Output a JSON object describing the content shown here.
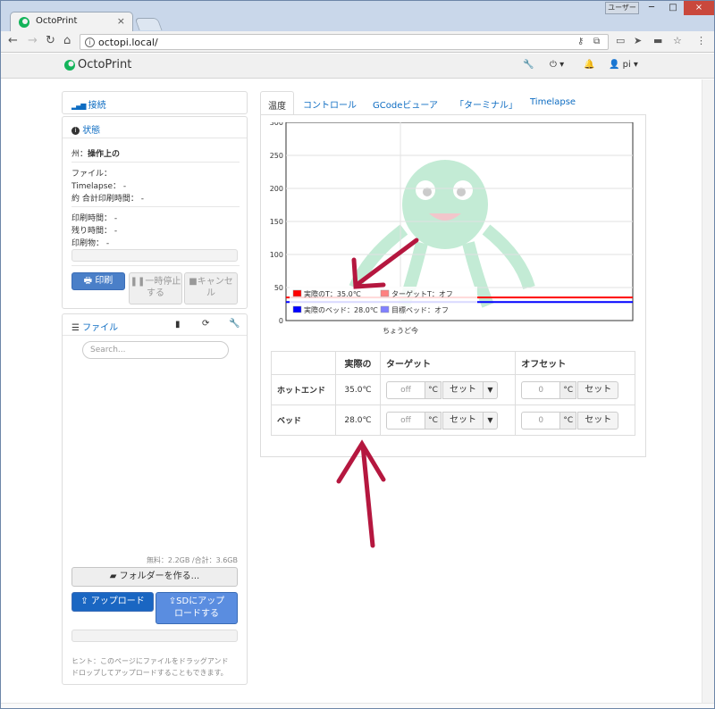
{
  "browser": {
    "tab_title": "OctoPrint",
    "tab_close": "×",
    "user_badge": "ユーザー",
    "url": "octopi.local/",
    "window_min": "─",
    "window_max": "□",
    "window_close": "×"
  },
  "navbar": {
    "brand": "OctoPrint",
    "wrench": "🔧",
    "power": "⏻ ▾",
    "bell": "🔔",
    "user": "👤 pi ▾"
  },
  "sidebar": {
    "connection": {
      "label": "接続"
    },
    "state": {
      "label": "状態",
      "state_label": "州",
      "state_value": "操作上の",
      "file_label": "ファイル：",
      "timelapse_label": "Timelapse：",
      "timelapse_value": "-",
      "approx_label": "約 合計印刷時間：",
      "approx_value": "-",
      "print_time_label": "印刷時間：",
      "print_time_value": "-",
      "remaining_label": "残り時間：",
      "remaining_value": "-",
      "printed_label": "印刷物：",
      "printed_value": "-",
      "progress": 0,
      "btn_print": "印刷",
      "btn_pause_1": "一時停止",
      "btn_pause_2": "する",
      "btn_cancel_1": "キャンセ",
      "btn_cancel_2": "ル"
    },
    "files": {
      "label": "ファイル",
      "search_placeholder": "Search...",
      "usage": "無料：2.2GB /合計：3.6GB",
      "btn_folder": "フォルダーを作る...",
      "btn_upload": "アップロード",
      "btn_sd_1": "SDにアップ",
      "btn_sd_2": "ロードする",
      "hint_1": "ヒント：このページにファイルをドラッグアンド",
      "hint_2": "ドロップしてアップロードすることもできます。"
    }
  },
  "main": {
    "tabs": [
      {
        "label": "温度"
      },
      {
        "label": "コントロール"
      },
      {
        "label": "GCodeビューア"
      },
      {
        "label": "「ターミナル」"
      },
      {
        "label": "Timelapse"
      }
    ],
    "table": {
      "headers": [
        "",
        "実際の",
        "ターゲット",
        "オフセット"
      ],
      "rows": [
        {
          "name": "ホットエンド",
          "actual": "35.0℃",
          "target_placeholder": "off",
          "unit": "°C",
          "set": "セット",
          "offset_placeholder": "0",
          "offset_unit": "°C",
          "offset_set": "セット"
        },
        {
          "name": "ベッド",
          "actual": "28.0℃",
          "target_placeholder": "off",
          "unit": "°C",
          "set": "セット",
          "offset_placeholder": "0",
          "offset_unit": "°C",
          "offset_set": "セット"
        }
      ]
    }
  },
  "chart_data": {
    "type": "line",
    "ylim": [
      0,
      300
    ],
    "yticks": [
      0,
      50,
      100,
      150,
      200,
      250,
      300
    ],
    "xlabel": "ちょうど今",
    "series": [
      {
        "name": "実際のT：35.0℃",
        "color": "#ff0000",
        "values": [
          35,
          35
        ]
      },
      {
        "name": "ターゲットT：オフ",
        "color": "#ff8080",
        "values": []
      },
      {
        "name": "実際のベッド：28.0℃",
        "color": "#0000ff",
        "values": [
          28,
          28
        ]
      },
      {
        "name": "目標ベッド：オフ",
        "color": "#8080ff",
        "values": []
      }
    ]
  }
}
